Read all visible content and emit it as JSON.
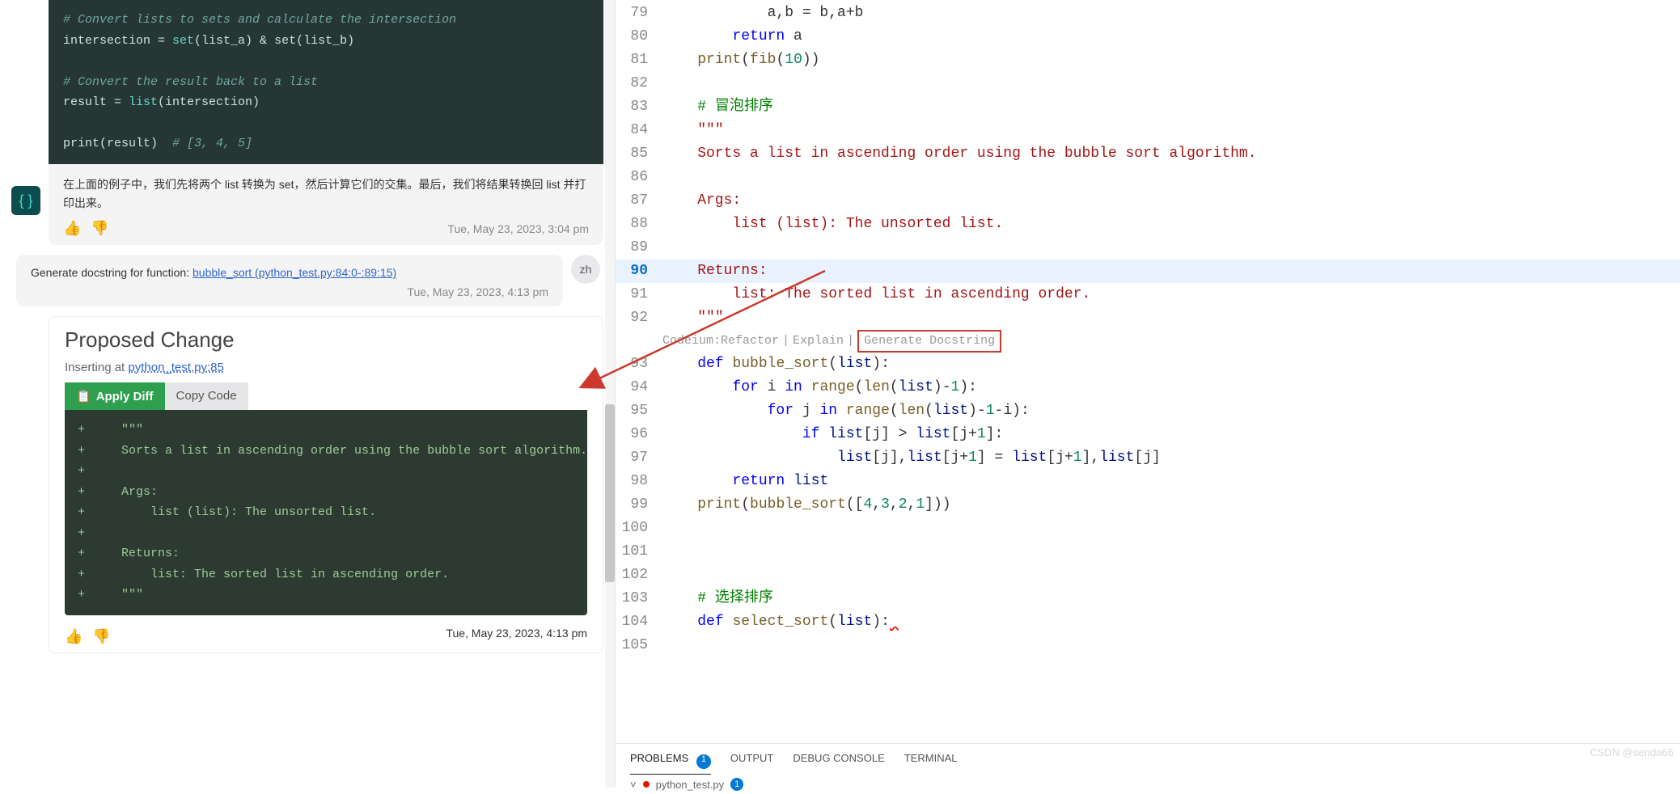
{
  "chat": {
    "assistant_block1": {
      "code_lines": [
        {
          "t": "comment",
          "text": "# Convert lists to sets and calculate the intersection"
        },
        {
          "t": "plain",
          "text": "intersection = set(list_a) & set(list_b)"
        },
        {
          "t": "blank",
          "text": ""
        },
        {
          "t": "comment",
          "text": "# Convert the result back to a list"
        },
        {
          "t": "plain",
          "text": "result = list(intersection)"
        },
        {
          "t": "blank",
          "text": ""
        },
        {
          "t": "mixed",
          "text": "print(result)  # [3, 4, 5]"
        }
      ],
      "explanation": "在上面的例子中，我们先将两个 list 转换为 set，然后计算它们的交集。最后，我们将结果转换回 list 并打印出来。",
      "timestamp": "Tue, May 23, 2023, 3:04 pm"
    },
    "user_msg": {
      "prefix": "Generate docstring for function: ",
      "link": "bubble_sort (python_test.py:84:0-:89:15)",
      "timestamp": "Tue, May 23, 2023, 4:13 pm",
      "avatar": "zh"
    },
    "proposed": {
      "title": "Proposed Change",
      "inserting_prefix": "Inserting at ",
      "inserting_link": "python_test.py:85",
      "apply_label": "Apply Diff",
      "copy_label": "Copy Code",
      "diff_lines": [
        "+     \"\"\"",
        "+     Sorts a list in ascending order using the bubble sort algorithm.",
        "+",
        "+     Args:",
        "+         list (list): The unsorted list.",
        "+",
        "+     Returns:",
        "+         list: The sorted list in ascending order.",
        "+     \"\"\""
      ],
      "timestamp": "Tue, May 23, 2023, 4:13 pm"
    }
  },
  "editor": {
    "codelens": {
      "prefix": "Codeium: ",
      "refactor": "Refactor",
      "explain": "Explain",
      "generate": "Generate Docstring"
    },
    "lines": [
      {
        "n": 79,
        "html": "            a,b = b,a+b",
        "cls": ""
      },
      {
        "n": 80,
        "html": "        <span class='c-kw'>return</span> a",
        "cls": ""
      },
      {
        "n": 81,
        "html": "    <span class='c-fn'>print</span>(<span class='c-fn'>fib</span>(<span class='c-num'>10</span>))",
        "cls": ""
      },
      {
        "n": 82,
        "html": "",
        "cls": ""
      },
      {
        "n": 83,
        "html": "    <span class='c-cmt'># 冒泡排序</span>",
        "cls": ""
      },
      {
        "n": 84,
        "html": "    <span class='c-str'>\"\"\"</span>",
        "cls": ""
      },
      {
        "n": 85,
        "html": "<span class='c-str'>    Sorts a list in ascending order using the bubble sort algorithm.</span>",
        "cls": ""
      },
      {
        "n": 86,
        "html": "",
        "cls": ""
      },
      {
        "n": 87,
        "html": "<span class='c-str'>    Args:</span>",
        "cls": ""
      },
      {
        "n": 88,
        "html": "<span class='c-str'>        list (list): The unsorted list.</span>",
        "cls": ""
      },
      {
        "n": 89,
        "html": "",
        "cls": ""
      },
      {
        "n": 90,
        "html": "<span class='c-str'>    Returns:</span>",
        "cls": "hl"
      },
      {
        "n": 91,
        "html": "<span class='c-str'>        list: The sorted list in ascending order.</span>",
        "cls": ""
      },
      {
        "n": 92,
        "html": "    <span class='c-str'>\"\"\"</span>",
        "cls": ""
      },
      {
        "n": "codelens",
        "html": "",
        "cls": ""
      },
      {
        "n": 93,
        "html": "    <span class='c-kw'>def</span> <span class='c-fn'>bubble_sort</span>(<span class='c-name'>list</span>):",
        "cls": ""
      },
      {
        "n": 94,
        "html": "        <span class='c-kw'>for</span> i <span class='c-kw'>in</span> <span class='c-fn'>range</span>(<span class='c-fn'>len</span>(<span class='c-name'>list</span>)-<span class='c-num'>1</span>):",
        "cls": ""
      },
      {
        "n": 95,
        "html": "            <span class='c-kw'>for</span> j <span class='c-kw'>in</span> <span class='c-fn'>range</span>(<span class='c-fn'>len</span>(<span class='c-name'>list</span>)-<span class='c-num'>1</span>-i):",
        "cls": ""
      },
      {
        "n": 96,
        "html": "                <span class='c-kw'>if</span> <span class='c-name'>list</span>[j] &gt; <span class='c-name'>list</span>[j+<span class='c-num'>1</span>]:",
        "cls": ""
      },
      {
        "n": 97,
        "html": "                    <span class='c-name'>list</span>[j],<span class='c-name'>list</span>[j+<span class='c-num'>1</span>] = <span class='c-name'>list</span>[j+<span class='c-num'>1</span>],<span class='c-name'>list</span>[j]",
        "cls": ""
      },
      {
        "n": 98,
        "html": "        <span class='c-kw'>return</span> <span class='c-name'>list</span>",
        "cls": ""
      },
      {
        "n": 99,
        "html": "    <span class='c-fn'>print</span>(<span class='c-fn'>bubble_sort</span>([<span class='c-num'>4</span>,<span class='c-num'>3</span>,<span class='c-num'>2</span>,<span class='c-num'>1</span>]))",
        "cls": ""
      },
      {
        "n": 100,
        "html": "",
        "cls": ""
      },
      {
        "n": 101,
        "html": "",
        "cls": ""
      },
      {
        "n": 102,
        "html": "",
        "cls": ""
      },
      {
        "n": 103,
        "html": "    <span class='c-cmt'># 选择排序</span>",
        "cls": ""
      },
      {
        "n": 104,
        "html": "    <span class='c-kw'>def</span> <span class='c-fn'>select_sort</span>(<span class='c-name'>list</span>):<span style='text-decoration: wavy underline #e51400;'> </span>",
        "cls": ""
      },
      {
        "n": 105,
        "html": "",
        "cls": ""
      }
    ]
  },
  "panel": {
    "tabs": {
      "problems": "PROBLEMS",
      "problems_count": "1",
      "output": "OUTPUT",
      "debug": "DEBUG CONSOLE",
      "terminal": "TERMINAL"
    },
    "filerow": {
      "chev": "˅",
      "name": "python_test.py",
      "count": "1"
    }
  },
  "watermark": "CSDN @senda66"
}
